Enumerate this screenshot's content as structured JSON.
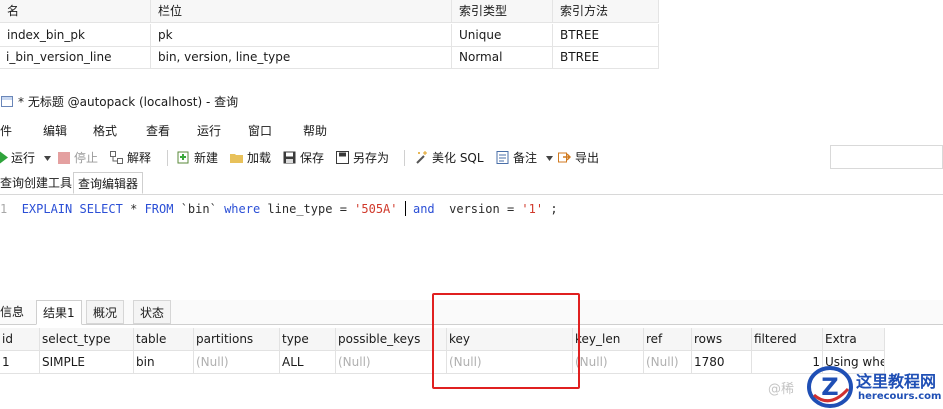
{
  "index_table": {
    "headers": [
      "名",
      "栏位",
      "索引类型",
      "索引方法"
    ],
    "rows": [
      [
        "index_bin_pk",
        "pk",
        "Unique",
        "BTREE"
      ],
      [
        "i_bin_version_line",
        "bin, version, line_type",
        "Normal",
        "BTREE"
      ]
    ]
  },
  "window": {
    "title": "* 无标题 @autopack (localhost) - 查询"
  },
  "menu": [
    "文件",
    "编辑",
    "格式",
    "查看",
    "运行",
    "窗口",
    "帮助"
  ],
  "toolbar": {
    "run": "运行",
    "stop": "停止",
    "explain": "解释",
    "new": "新建",
    "load": "加载",
    "save": "保存",
    "save_as": "另存为",
    "beautify": "美化 SQL",
    "comment": "备注",
    "export": "导出"
  },
  "editor_tabs": [
    "查询创建工具",
    "查询编辑器"
  ],
  "editor": {
    "line_number": "1",
    "tokens": {
      "explain": "EXPLAIN",
      "select": "SELECT",
      "star": "*",
      "from": "FROM",
      "table": "`bin`",
      "where": "where",
      "col1": "line_type",
      "eq1": "=",
      "val1": "'505A'",
      "and": "and",
      "col2": "version",
      "eq2": "=",
      "val2": "'1'",
      "semi": ";"
    }
  },
  "result_tabs": [
    "信息",
    "结果1",
    "概况",
    "状态"
  ],
  "result_grid": {
    "headers": [
      "id",
      "select_type",
      "table",
      "partitions",
      "type",
      "possible_keys",
      "key",
      "key_len",
      "ref",
      "rows",
      "filtered",
      "Extra"
    ],
    "row": [
      "1",
      "SIMPLE",
      "bin",
      "(Null)",
      "ALL",
      "(Null)",
      "(Null)",
      "(Null)",
      "(Null)",
      "1780",
      "1",
      "Using whe"
    ]
  },
  "watermark": {
    "text": "@稀",
    "site_cn": "这里教程网",
    "site_url": "herecours.com",
    "logo_letter": "Z"
  },
  "colors": {
    "keyword": "#2b4fd6",
    "string": "#d0392b",
    "highlight_box": "#e02020",
    "logo_blue": "#1f4fb5"
  }
}
